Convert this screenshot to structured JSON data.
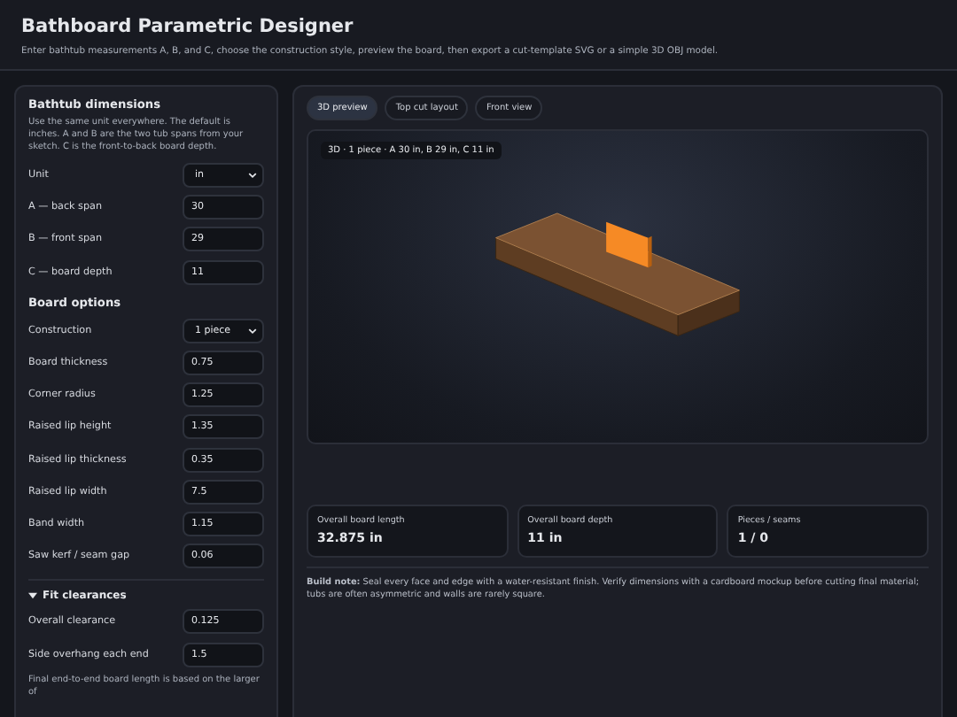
{
  "header": {
    "title": "Bathboard Parametric Designer",
    "subtitle": "Enter bathtub measurements A, B, and C, choose the construction style, preview the board, then export a cut-template SVG or a simple 3D OBJ model."
  },
  "sidebar": {
    "sections": [
      {
        "kind": "plain",
        "title": "Bathtub dimensions",
        "description": "Use the same unit everywhere. The default is inches. A and B are the two tub spans from your sketch. C is the front-to-back board depth.",
        "fields": [
          {
            "label": "Unit",
            "value": "in",
            "kind": "select"
          },
          {
            "label": "A — back span",
            "value": "30",
            "kind": "input"
          },
          {
            "label": "B — front span",
            "value": "29",
            "kind": "input"
          },
          {
            "label": "C — board depth",
            "value": "11",
            "kind": "input"
          }
        ]
      },
      {
        "kind": "plain",
        "title": "Board options",
        "fields": [
          {
            "label": "Construction",
            "value": "1 piece",
            "kind": "select"
          },
          {
            "label": "Board thickness",
            "value": "0.75",
            "kind": "input"
          },
          {
            "label": "Corner radius",
            "value": "1.25",
            "kind": "input"
          },
          {
            "label": "Raised lip height",
            "value": "1.35",
            "kind": "input"
          },
          {
            "label": "Raised lip thickness",
            "value": "0.35",
            "kind": "input"
          },
          {
            "label": "Raised lip width",
            "value": "7.5",
            "kind": "input"
          },
          {
            "label": "Band width",
            "value": "1.15",
            "kind": "input"
          },
          {
            "label": "Saw kerf / seam gap",
            "value": "0.06",
            "kind": "input"
          }
        ]
      },
      {
        "kind": "collapsible",
        "title": "Fit clearances",
        "expanded": true,
        "fields": [
          {
            "label": "Overall clearance",
            "value": "0.125",
            "kind": "input"
          },
          {
            "label": "Side overhang each end",
            "value": "1.5",
            "kind": "input"
          }
        ],
        "note": "Final end-to-end board length is based on the larger of"
      }
    ]
  },
  "tabs": [
    {
      "label": "3D preview",
      "selected": true
    },
    {
      "label": "Top cut layout",
      "selected": false
    },
    {
      "label": "Front view",
      "selected": false
    }
  ],
  "preview": {
    "caption": "3D · 1 piece · A 30 in, B 29 in, C 11 in"
  },
  "stats": [
    {
      "label": "Overall board length",
      "value": "32.875 in"
    },
    {
      "label": "Overall board depth",
      "value": "11 in"
    },
    {
      "label": "Pieces / seams",
      "value": "1 / 0"
    }
  ],
  "build_note": "**Build note:** Seal every face and edge with a water-resistant finish. Verify dimensions with a cardboard mockup before cutting final material; tubs are often asymmetric and walls are rarely square."
}
